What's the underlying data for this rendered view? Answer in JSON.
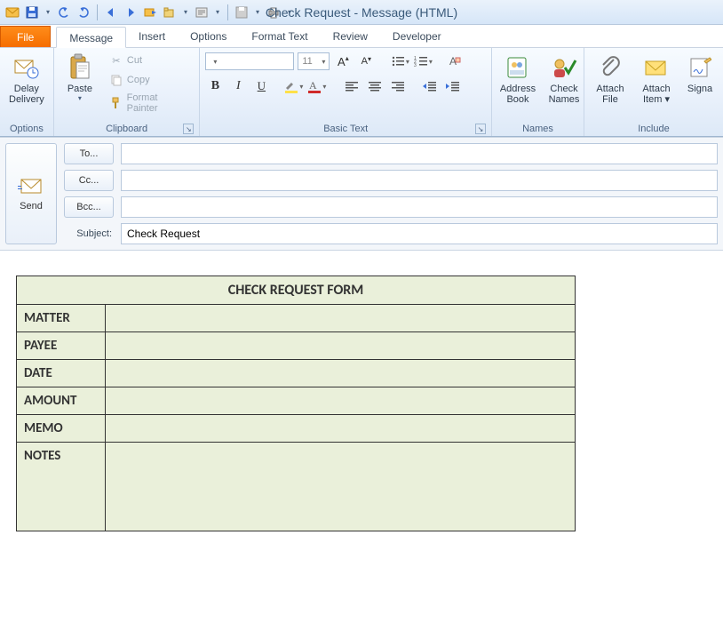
{
  "window": {
    "title": "Check Request - Message (HTML)"
  },
  "tabs": {
    "file": "File",
    "items": [
      "Message",
      "Insert",
      "Options",
      "Format Text",
      "Review",
      "Developer"
    ],
    "active": "Message"
  },
  "ribbon": {
    "options": {
      "delay": "Delay\nDelivery",
      "label": "Options"
    },
    "clipboard": {
      "paste": "Paste",
      "cut": "Cut",
      "copy": "Copy",
      "fmt": "Format Painter",
      "label": "Clipboard"
    },
    "basictext": {
      "font_placeholder": "",
      "size": "11",
      "label": "Basic Text"
    },
    "names": {
      "addr": "Address\nBook",
      "check": "Check\nNames",
      "label": "Names"
    },
    "include": {
      "attachfile": "Attach\nFile",
      "attachitem": "Attach\nItem ▾",
      "sign": "Signa",
      "label": "Include"
    }
  },
  "compose": {
    "send": "Send",
    "to": "To...",
    "cc": "Cc...",
    "bcc": "Bcc...",
    "subject_label": "Subject:",
    "subject_value": "Check Request"
  },
  "form": {
    "title": "CHECK REQUEST FORM",
    "rows": [
      {
        "label": "MATTER",
        "value": ""
      },
      {
        "label": "PAYEE",
        "value": ""
      },
      {
        "label": "DATE",
        "value": ""
      },
      {
        "label": "AMOUNT",
        "value": ""
      },
      {
        "label": "MEMO",
        "value": ""
      },
      {
        "label": "NOTES",
        "value": ""
      }
    ]
  }
}
